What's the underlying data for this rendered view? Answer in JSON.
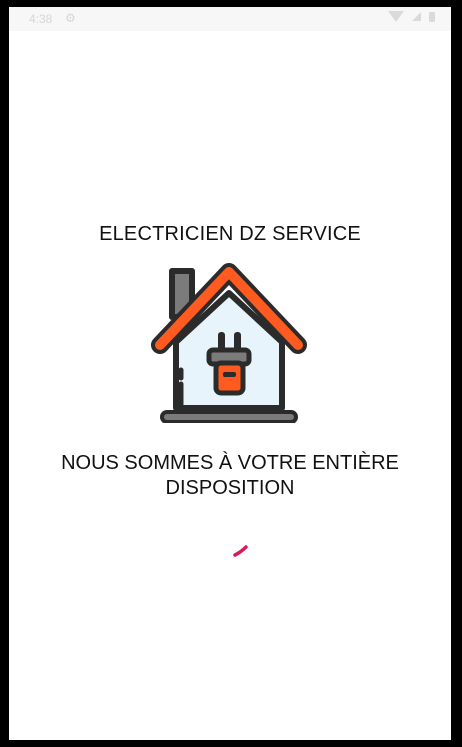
{
  "status_bar": {
    "time": "4:38",
    "settings_icon": "gear-icon",
    "wifi_icon": "wifi-icon",
    "signal_icon": "cell-signal-icon",
    "battery_icon": "battery-icon"
  },
  "splash": {
    "title": "ELECTRICIEN DZ SERVICE",
    "logo_icon": "house-plug-icon",
    "tagline": "NOUS SOMMES À VOTRE ENTIÈRE DISPOSITION",
    "loading_icon": "loading-spinner-icon"
  },
  "colors": {
    "roof": "#ff5a1f",
    "outline": "#2b2b2b",
    "wall": "#e8f4fb",
    "chimney": "#7b7b7b",
    "spinner": "#d81b60",
    "background": "#ffffff"
  }
}
